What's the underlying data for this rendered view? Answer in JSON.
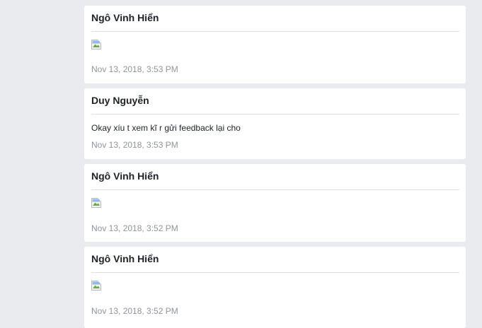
{
  "messages": [
    {
      "sender": "Ngô Vinh Hiển",
      "content_type": "image",
      "image_state": "broken-image-icon",
      "time": "Nov 13, 2018, 3:53 PM"
    },
    {
      "sender": "Duy Nguyễn",
      "content_type": "text",
      "text": "Okay xíu t xem kĩ r gửi feedback lại cho",
      "time": "Nov 13, 2018, 3:53 PM"
    },
    {
      "sender": "Ngô Vinh Hiển",
      "content_type": "image",
      "image_state": "broken-image-icon",
      "time": "Nov 13, 2018, 3:52 PM"
    },
    {
      "sender": "Ngô Vinh Hiển",
      "content_type": "image",
      "image_state": "broken-image-icon",
      "time": "Nov 13, 2018, 3:52 PM"
    }
  ],
  "colors": {
    "page_background": "#e9ebee",
    "card_background": "#ffffff",
    "sender_text": "#1d2129",
    "timestamp_text": "#90949c",
    "divider": "#dddfe2"
  }
}
